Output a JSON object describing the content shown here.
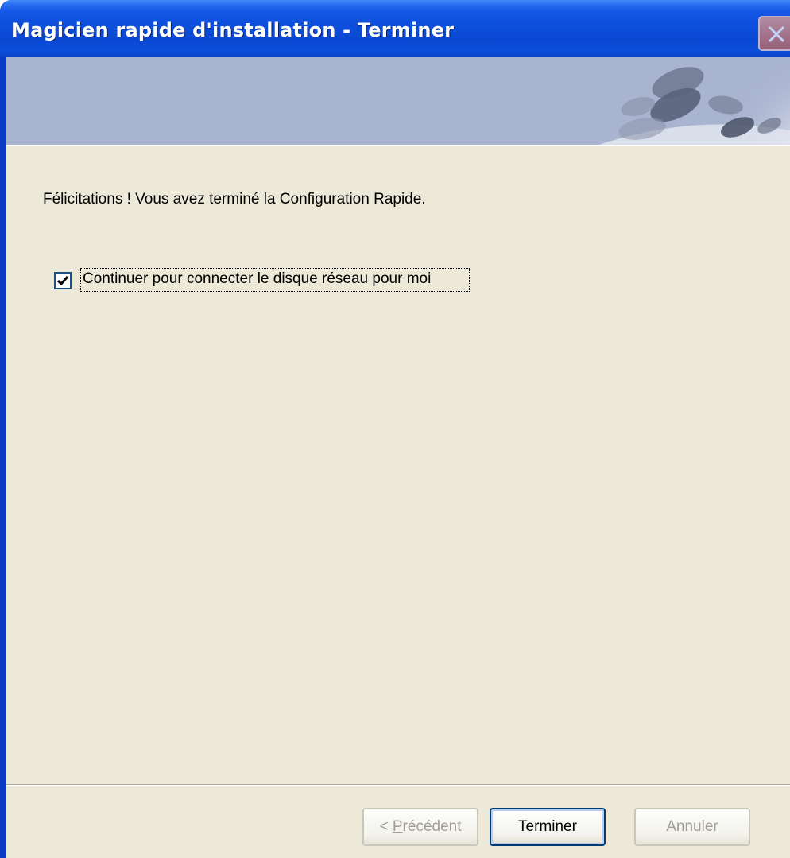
{
  "window": {
    "title": "Magicien rapide d'installation - Terminer"
  },
  "content": {
    "message": "Félicitations ! Vous avez terminé la Configuration Rapide.",
    "checkbox": {
      "label": "Continuer pour connecter le disque réseau pour moi",
      "checked": true
    }
  },
  "buttons": {
    "previous": {
      "prefix": "< ",
      "underlined": "P",
      "rest": "récédent",
      "enabled": false
    },
    "finish": {
      "label": "Terminer",
      "enabled": true
    },
    "cancel": {
      "label": "Annuler",
      "enabled": false
    }
  },
  "colors": {
    "titlebar": "#0c4fdb",
    "client_bg": "#ece9d8",
    "banner_bg": "#a9b4d0",
    "disabled_text": "#a19f93"
  },
  "icons": {
    "close": "close-icon",
    "checkmark": "checkmark-icon",
    "banner": "banner-decoration"
  }
}
